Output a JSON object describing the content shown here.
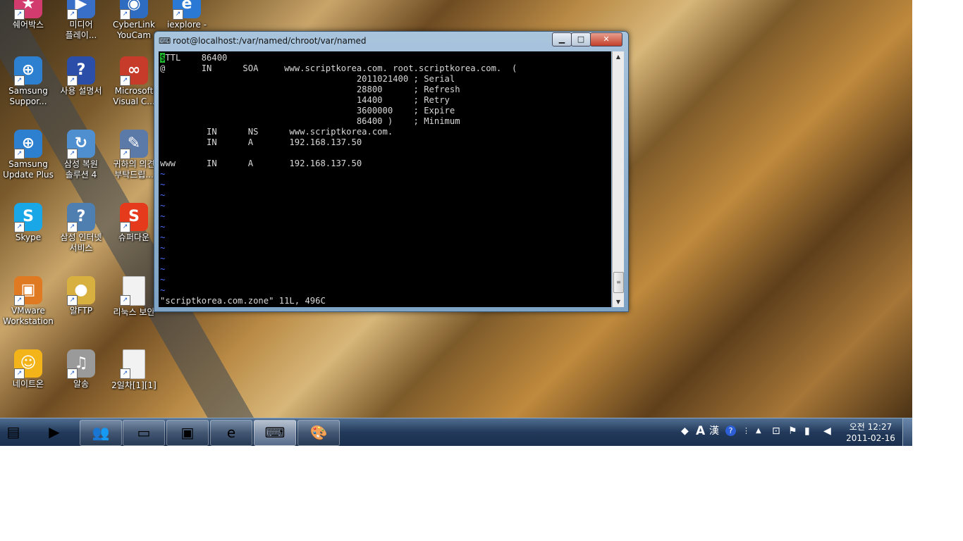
{
  "desktop": {
    "icons": [
      {
        "label_line1": "쉐어박스",
        "label_line2": "",
        "symbol": "★",
        "color": "#d23b6e",
        "icon": "sharebox-icon"
      },
      {
        "label_line1": "미디어",
        "label_line2": "플레이...",
        "symbol": "▶",
        "color": "#3a6fc8",
        "icon": "media-player-icon"
      },
      {
        "label_line1": "CyberLink",
        "label_line2": "YouCam",
        "symbol": "◉",
        "color": "#2d6cc0",
        "icon": "youcam-icon"
      },
      {
        "label_line1": "iexplore -",
        "label_line2": "",
        "symbol": "e",
        "color": "#2a79d4",
        "icon": "iexplore-icon"
      },
      {
        "label_line1": "Samsung",
        "label_line2": "Suppor...",
        "symbol": "⊕",
        "color": "#2d7fd0",
        "icon": "samsung-support-icon"
      },
      {
        "label_line1": "사용 설명서",
        "label_line2": "",
        "symbol": "?",
        "color": "#2b4fa8",
        "icon": "help-book-icon"
      },
      {
        "label_line1": "Microsoft",
        "label_line2": "Visual C...",
        "symbol": "∞",
        "color": "#c63b2a",
        "icon": "visual-c-icon"
      },
      {
        "label_line1": "Samsung",
        "label_line2": "Update Plus",
        "symbol": "⊕",
        "color": "#2d7fd0",
        "icon": "samsung-update-icon"
      },
      {
        "label_line1": "삼성 복원",
        "label_line2": "솔루션 4",
        "symbol": "↻",
        "color": "#4f8fd0",
        "icon": "recovery-icon"
      },
      {
        "label_line1": "귀하의 의견",
        "label_line2": "부탁드립...",
        "symbol": "✎",
        "color": "#5b7aa8",
        "icon": "feedback-icon"
      },
      {
        "label_line1": "Skype",
        "label_line2": "",
        "symbol": "S",
        "color": "#1aa7e8",
        "icon": "skype-icon"
      },
      {
        "label_line1": "삼성 인터넷",
        "label_line2": "서비스",
        "symbol": "?",
        "color": "#4f7fb0",
        "icon": "internet-service-icon"
      },
      {
        "label_line1": "슈퍼다운",
        "label_line2": "",
        "symbol": "S",
        "color": "#e63a1c",
        "icon": "superdown-icon"
      },
      {
        "label_line1": "VMware",
        "label_line2": "Workstation",
        "symbol": "▣",
        "color": "#e07a22",
        "icon": "vmware-icon"
      },
      {
        "label_line1": "알FTP",
        "label_line2": "",
        "symbol": "●",
        "color": "#d8b040",
        "icon": "alftp-icon"
      },
      {
        "label_line1": "리눅스 보안",
        "label_line2": "",
        "symbol": "",
        "color": "#f2f2f2",
        "icon": "document-icon"
      },
      {
        "label_line1": "네이트온",
        "label_line2": "",
        "symbol": "☺",
        "color": "#f2b418",
        "icon": "nateon-icon"
      },
      {
        "label_line1": "알송",
        "label_line2": "",
        "symbol": "♫",
        "color": "#9a9a9a",
        "icon": "alsong-icon"
      },
      {
        "label_line1": "2일차[1][1]",
        "label_line2": "",
        "symbol": "",
        "color": "#f2f2f2",
        "icon": "document-icon"
      }
    ]
  },
  "terminal": {
    "title": "root@localhost:/var/named/chroot/var/named",
    "cursor_char": "$",
    "first_line_rest": "TTL    86400",
    "lines": [
      "@       IN      SOA     www.scriptkorea.com. root.scriptkorea.com.  (",
      "                                      2011021400 ; Serial",
      "                                      28800      ; Refresh",
      "                                      14400      ; Retry",
      "                                      3600000    ; Expire",
      "                                      86400 )    ; Minimum",
      "         IN      NS      www.scriptkorea.com.",
      "         IN      A       192.168.137.50",
      "",
      "www      IN      A       192.168.137.50"
    ],
    "tildes": [
      "~",
      "~",
      "~",
      "~",
      "~",
      "~",
      "~",
      "~",
      "~",
      "~",
      "~",
      "~"
    ],
    "status": "\"scriptkorea.com.zone\" 11L, 496C",
    "buttons": {
      "minimize": "▁",
      "maximize": "□",
      "close": "✕"
    }
  },
  "taskbar": {
    "buttons": [
      {
        "symbol": "▤",
        "icon": "explorer-icon",
        "active": false
      },
      {
        "symbol": "▶",
        "icon": "media-icon",
        "active": false
      },
      {
        "symbol": "👥",
        "icon": "messenger-icon",
        "active": false
      },
      {
        "symbol": "▭",
        "icon": "remote-desktop-icon",
        "active": false
      },
      {
        "symbol": "▣",
        "icon": "vmware-icon",
        "active": false
      },
      {
        "symbol": "e",
        "icon": "internet-explorer-icon",
        "active": false
      },
      {
        "symbol": "⌨",
        "icon": "putty-icon",
        "active": true
      },
      {
        "symbol": "🎨",
        "icon": "paint-icon",
        "active": false
      }
    ],
    "tray": {
      "ime_a": "A",
      "ime_han": "漢",
      "help": "?",
      "clock_time": "오전 12:27",
      "clock_date": "2011-02-16"
    }
  }
}
